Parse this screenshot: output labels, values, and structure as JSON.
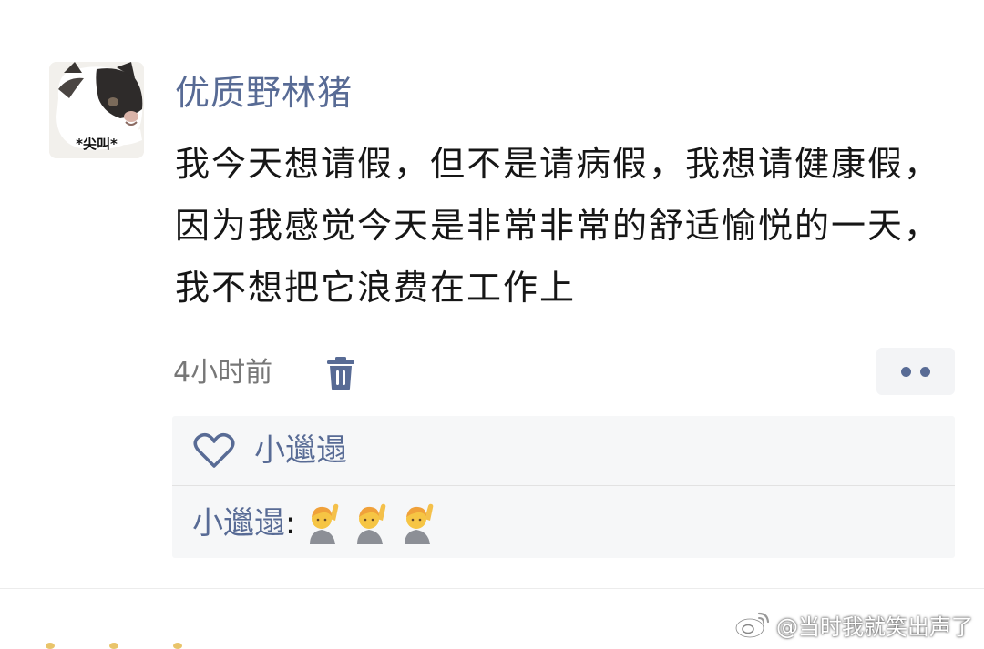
{
  "post": {
    "author": "优质野林猪",
    "avatar_caption": "*尖叫*",
    "text": "我今天想请假，但不是请病假，我想请健康假，因为我感觉今天是非常非常的舒适愉悦的一天，我不想把它浪费在工作上",
    "timestamp": "4小时前"
  },
  "icons": {
    "delete": "trash-icon",
    "more": "more-dots-icon",
    "like": "heart-icon",
    "emoji": "person-raising-hand-emoji",
    "watermark": "weibo-icon"
  },
  "likes": {
    "names": "小邋遢"
  },
  "comments": [
    {
      "author": "小邋遢",
      "separator": ":",
      "emojis": [
        "🙋‍♂️",
        "🙋‍♂️",
        "🙋‍♂️"
      ]
    }
  ],
  "watermark": {
    "text": "@当时我就笑出声了"
  },
  "colors": {
    "name_blue": "#586b95",
    "panel_bg": "#f6f7f8",
    "text": "#161616",
    "timestamp": "#777777"
  }
}
